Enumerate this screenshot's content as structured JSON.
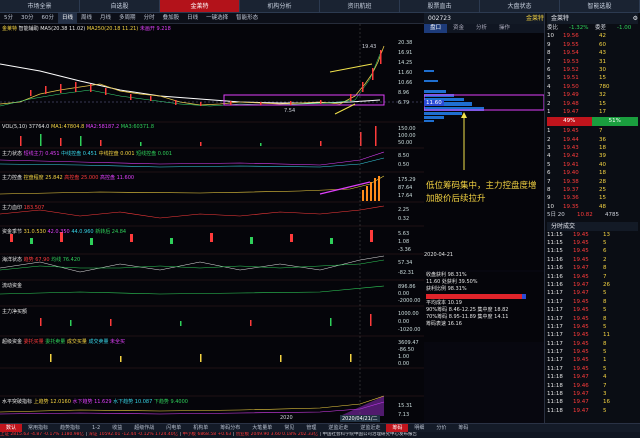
{
  "topnav": [
    "市场全景",
    "自选股",
    "金莱特",
    "机构分析",
    "资讯航班",
    "股票直击",
    "大盘状态",
    "智能选股"
  ],
  "toolbar": [
    "5分",
    "30分",
    "60分",
    "日线",
    "周线",
    "月线",
    "多周期",
    "分时",
    "叠加股",
    "日线",
    "一键选择",
    "智能形态"
  ],
  "stock": {
    "code": "002723",
    "name": "金莱特"
  },
  "main_pane": {
    "label": "金莱特",
    "indicator": "智能辅助",
    "ma": "MA5(20.38 11.02)",
    "ma2": "MA250(20.18 11.21)",
    "extra": "未画开 9.218",
    "hi": "19.43",
    "lo": "7.54",
    "axis": [
      "20.38",
      "16.91",
      "14.25",
      "11.60",
      "10.66",
      "8.96",
      "6.79"
    ],
    "cost_label": "11.60"
  },
  "vol_pane": {
    "label": "VOL(5,10)",
    "v1": "37764.0",
    "v2": "MA1:47804.8",
    "v3": "MA2:58187.2",
    "v4": "MA3:60371.8",
    "axis": [
      "150.00",
      "100.00",
      "50.00"
    ]
  },
  "p_status": {
    "label": "主力状态",
    "a": "短线主力 0.451",
    "b": "中线控盘 0.451",
    "c": "中线控盘 0.001",
    "d": "短线控盘 0.001",
    "axis": [
      "8.50",
      "0.50"
    ]
  },
  "p_ctrl": {
    "label": "主力控盘",
    "a": "控盘程度 25.842",
    "b": "高控盘 25.000",
    "c": "高控盘 11.600",
    "axis": [
      "175.29",
      "87.64",
      "17.64"
    ]
  },
  "p_cycle": {
    "label": "主力血印",
    "v": "183.507",
    "axis": [
      "2.25",
      "0.32"
    ]
  },
  "p_flow": {
    "label": "资金季节",
    "a": "31.0.530",
    "b": "42.0.350",
    "c": "44.0.960",
    "d": "新转后 24.84",
    "axis": [
      "5.63",
      "1.08",
      "-3.36"
    ]
  },
  "p_sea": {
    "label": "海洋状态",
    "a": "趋势 67.90",
    "b": "均线 76.420",
    "axis": [
      "57.34",
      "-82.31"
    ]
  },
  "p_money": {
    "label": "流动资金",
    "axis": [
      "896.86",
      "0.00",
      "-2000.00"
    ]
  },
  "p_net": {
    "label": "主力净买额",
    "axis": [
      "1000.00",
      "0.00",
      "-1020.00"
    ]
  },
  "p_ladder": {
    "label": "超级资金",
    "a": "委托买量",
    "b": "委托卖量",
    "c": "成交买量",
    "d": "成交卖量",
    "e": "未全买",
    "axis": [
      "3609.47",
      "-86.50",
      "1.00",
      "0.00"
    ]
  },
  "p_water": {
    "label": "水平突破指标",
    "a": "上趋势 12.0160",
    "b": "水下趋势 11.629",
    "c": "水下趋势 10.087",
    "d": "下趋势 9.4000",
    "axis": [
      "15.31",
      "7.13"
    ]
  },
  "annotation": "低位筹码集中，主力控盘度增加股价后续拉升",
  "date_label": "2020",
  "date_label2": "2020/04/21/二",
  "tabbar": [
    "数认",
    "常用指标",
    "趋势指标",
    "1-2",
    "收益",
    "超级作战",
    "闪电单",
    "机构单",
    "筹码分布",
    "大笔量单",
    "常见",
    "管理",
    "逆监近走",
    "逆监近走",
    "筹码",
    "明细",
    "分价",
    "筹码"
  ],
  "right": {
    "tabs": [
      "盘口",
      "资金",
      "分析",
      "操作"
    ],
    "header": [
      "委比",
      "-1.32%",
      "委差",
      "-1.00"
    ],
    "sell": [
      {
        "n": "10",
        "p": "19.56",
        "v": "42"
      },
      {
        "n": "9",
        "p": "19.55",
        "v": "60"
      },
      {
        "n": "8",
        "p": "19.54",
        "v": "43"
      },
      {
        "n": "7",
        "p": "19.53",
        "v": "31"
      },
      {
        "n": "6",
        "p": "19.52",
        "v": "30"
      },
      {
        "n": "5",
        "p": "19.51",
        "v": "15"
      },
      {
        "n": "4",
        "p": "19.50",
        "v": "780"
      },
      {
        "n": "3",
        "p": "19.49",
        "v": "32"
      },
      {
        "n": "2",
        "p": "19.48",
        "v": "15"
      },
      {
        "n": "1",
        "p": "19.47",
        "v": "17"
      }
    ],
    "buy_ratio": "49%",
    "sell_ratio": "51%",
    "buy": [
      {
        "n": "1",
        "p": "19.45",
        "v": "7"
      },
      {
        "n": "2",
        "p": "19.44",
        "v": "36"
      },
      {
        "n": "3",
        "p": "19.43",
        "v": "18"
      },
      {
        "n": "4",
        "p": "19.42",
        "v": "39"
      },
      {
        "n": "5",
        "p": "19.41",
        "v": "40"
      },
      {
        "n": "6",
        "p": "19.40",
        "v": "18"
      },
      {
        "n": "7",
        "p": "19.38",
        "v": "28"
      },
      {
        "n": "8",
        "p": "19.37",
        "v": "25"
      },
      {
        "n": "9",
        "p": "19.36",
        "v": "15"
      },
      {
        "n": "10",
        "p": "19.35",
        "v": "48"
      }
    ],
    "summary": [
      "5日 20",
      "10.82",
      "4785"
    ],
    "ticks_label": "分时成交",
    "ticks": [
      {
        "t": "11:15",
        "p": "19.45",
        "v": "13"
      },
      {
        "t": "11:15",
        "p": "19.45",
        "v": "5"
      },
      {
        "t": "11:15",
        "p": "19.45",
        "v": "6"
      },
      {
        "t": "11:16",
        "p": "19.45",
        "v": "2"
      },
      {
        "t": "11:16",
        "p": "19.47",
        "v": "8"
      },
      {
        "t": "11:16",
        "p": "19.45",
        "v": "7"
      },
      {
        "t": "11:16",
        "p": "19.47",
        "v": "26"
      },
      {
        "t": "11:17",
        "p": "19.47",
        "v": "5"
      },
      {
        "t": "11:17",
        "p": "19.45",
        "v": "8"
      },
      {
        "t": "11:17",
        "p": "19.45",
        "v": "5"
      },
      {
        "t": "11:17",
        "p": "19.45",
        "v": "8"
      },
      {
        "t": "11:17",
        "p": "19.45",
        "v": "5"
      },
      {
        "t": "11:17",
        "p": "19.45",
        "v": "11"
      },
      {
        "t": "11:17",
        "p": "19.45",
        "v": "8"
      },
      {
        "t": "11:17",
        "p": "19.45",
        "v": "5"
      },
      {
        "t": "11:17",
        "p": "19.45",
        "v": "1"
      },
      {
        "t": "11:17",
        "p": "19.45",
        "v": "5"
      },
      {
        "t": "11:18",
        "p": "19.47",
        "v": "4"
      },
      {
        "t": "11:18",
        "p": "19.46",
        "v": "7"
      },
      {
        "t": "11:18",
        "p": "19.47",
        "v": "3"
      },
      {
        "t": "11:18",
        "p": "19.47",
        "v": "16"
      },
      {
        "t": "11:18",
        "p": "19.47",
        "v": "5"
      }
    ],
    "chip": {
      "date": "2020-04-21",
      "profit": "收盘获利 98.31%",
      "avg": "11.60 处获利 39.50%",
      "ratio": "获利比例 98.31%",
      "cost": "平均成本 10.19",
      "c90": "90%筹码 8.46-12.25 集中度 18.82",
      "c70": "70%筹码 8.95-11.89 集中度 14.11",
      "note": "筹码表速 16.16"
    }
  },
  "bottom": {
    "sh": "上证 2815.63 -4.87 -0.17% 1180.98亿",
    "sz": "深证 10592.01 -12.44 -0.12% 1724.40亿",
    "zx": "中小板 6868.58 +0.63",
    "cy": "创业板 2049.90 3.60 0.18% 202.33亿",
    "news": "中国社会科学院中国公司治理研究中心发布报告"
  }
}
